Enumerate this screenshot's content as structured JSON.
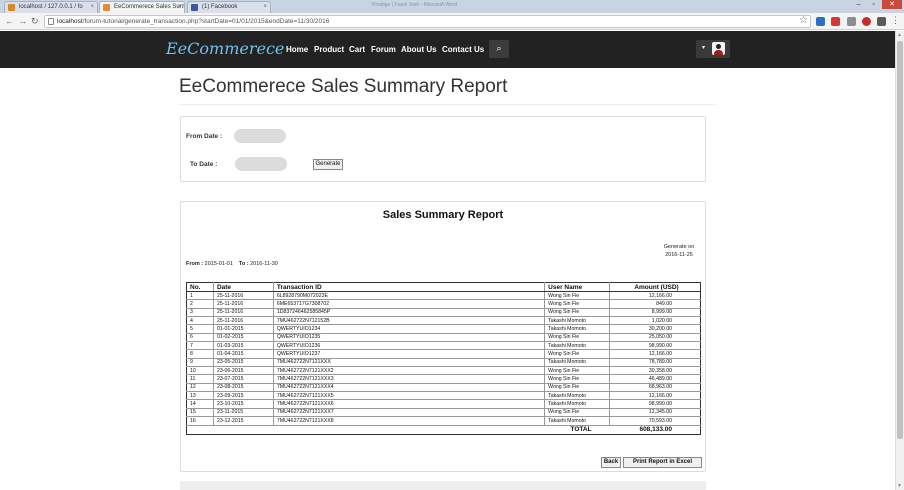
{
  "browser": {
    "tabs": [
      {
        "label": "localhost / 127.0.0.1 / fo",
        "active": false,
        "icon_color": "#d9882a"
      },
      {
        "label": "EeCommerece Sales Sum",
        "active": true,
        "icon_color": "#e8883a"
      },
      {
        "label": "(1) Facebook",
        "active": false,
        "icon_color": "#3b5998"
      }
    ],
    "ghost_title": "Prestige | Frank Josh - Microsoft Word",
    "url_host": "localhost",
    "url_path": "/forum-tutorial/generate_transaction.php?startDate=01/01/2015&endDate=11/30/2016",
    "win_min": "–",
    "win_max": "▫",
    "win_close": "✕",
    "back_icon": "←",
    "forward_icon": "→",
    "reload_icon": "↻",
    "star_icon": "☆",
    "menu_icon": "⋮"
  },
  "nav": {
    "brand": "EeCommerece",
    "links": [
      "Home",
      "Product",
      "Cart",
      "Forum",
      "About Us",
      "Contact Us"
    ],
    "search_icon": "⌕",
    "caret": "▾"
  },
  "page": {
    "title": "EeCommerece Sales Summary Report"
  },
  "filter": {
    "from_label": "From Date :",
    "to_label": "To Date    :",
    "from_value": "",
    "to_value": "",
    "generate_label": "Generate"
  },
  "report": {
    "title": "Sales Summary Report",
    "generate_on_label": "Generate on",
    "generate_on_value": "2016-11-25",
    "from_label": "From :",
    "from_value": "2015-01-01",
    "to_label": "To :",
    "to_value": "2016-11-30",
    "columns": [
      "No.",
      "Date",
      "Transaction ID",
      "User Name",
      "Amount (USD)"
    ],
    "rows": [
      [
        "1",
        "25-11-2016",
        "6L8928790M072023E",
        "Wong Sin Fie",
        "12,166.00"
      ],
      [
        "2",
        "25-11-2016",
        "6ME653717G7308702",
        "Wong Sin Fie",
        "849.00"
      ],
      [
        "3",
        "25-11-2016",
        "1D837246462585845P",
        "Wong Sin Fie",
        "8,999.00"
      ],
      [
        "4",
        "25-11-2016",
        "7MU462722N712152B",
        "Takashi Momoto",
        "1,020.00"
      ],
      [
        "5",
        "01-01-2015",
        "QWERTYUIO1234",
        "Takashi Momoto",
        "30,200.00"
      ],
      [
        "6",
        "01-02-2015",
        "QWERTYUIO1235",
        "Wong Sin Fie",
        "25,050.00"
      ],
      [
        "7",
        "01-03-2015",
        "QWERTYUIO1236",
        "Takashi Momoto",
        "98,990.00"
      ],
      [
        "8",
        "01-04-2015",
        "QWERTYUIO1237",
        "Wong Sin Fie",
        "12,166.00"
      ],
      [
        "9",
        "23-05-2015",
        "7MU462722N7121XXX",
        "Takashi Momoto",
        "78,789.00"
      ],
      [
        "10",
        "23-06-2015",
        "7MU462722N7121XXX2",
        "Wong Sin Fie",
        "30,358.00"
      ],
      [
        "11",
        "23-07-2015",
        "7MU462722N7121XXX3",
        "Wong Sin Fie",
        "46,489.00"
      ],
      [
        "12",
        "23-08-2015",
        "7MU462722N7121XXX4",
        "Wong Sin Fie",
        "68,963.00"
      ],
      [
        "13",
        "23-09-2015",
        "7MU462722N7121XXX5",
        "Takashi Momoto",
        "12,166.00"
      ],
      [
        "14",
        "23-10-2015",
        "7MU462722N7121XXX6",
        "Takashi Momoto",
        "98,990.00"
      ],
      [
        "15",
        "23-11-2015",
        "7MU462722N7121XXX7",
        "Wong Sin Fie",
        "12,345.00"
      ],
      [
        "16",
        "23-12-2015",
        "7MU462722N7121XXX8",
        "Takashi Momoto",
        "70,593.00"
      ]
    ],
    "total_label": "TOTAL",
    "total_value": "608,133.00",
    "back_label": "Back",
    "print_label": "Print Report in Excel"
  },
  "colors": {
    "navbar": "#222222",
    "brand": "#6fc1ee"
  }
}
